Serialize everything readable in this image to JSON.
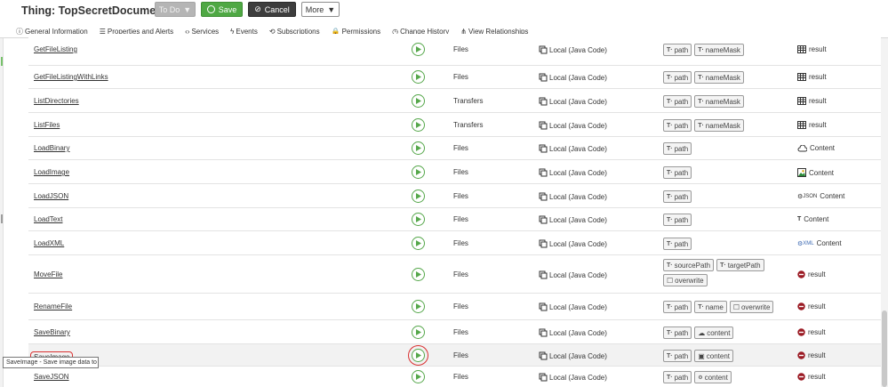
{
  "header": {
    "title_prefix": "Thing:",
    "thing_name": "TopSecretDocuments",
    "todo_label": "To Do",
    "save_label": "Save",
    "cancel_label": "Cancel",
    "more_label": "More"
  },
  "tabs": [
    {
      "label": "General Information",
      "icon": "info-icon"
    },
    {
      "label": "Properties and Alerts",
      "icon": "list-icon"
    },
    {
      "label": "Services",
      "icon": "code-icon"
    },
    {
      "label": "Events",
      "icon": "lightning-icon"
    },
    {
      "label": "Subscriptions",
      "icon": "subscription-icon"
    },
    {
      "label": "Permissions",
      "icon": "lock-icon"
    },
    {
      "label": "Change History",
      "icon": "history-icon"
    },
    {
      "label": "View Relationships",
      "icon": "relationships-icon"
    }
  ],
  "services": [
    {
      "name": "GetFileListing",
      "category": "Files",
      "source": "Local (Java Code)",
      "params": [
        {
          "type": "T",
          "name": "path"
        },
        {
          "type": "T",
          "name": "nameMask"
        }
      ],
      "result": "result",
      "result_icon": "table-icon"
    },
    {
      "name": "GetFileListingWithLinks",
      "category": "Files",
      "source": "Local (Java Code)",
      "params": [
        {
          "type": "T",
          "name": "path"
        },
        {
          "type": "T",
          "name": "nameMask"
        }
      ],
      "result": "result",
      "result_icon": "table-icon"
    },
    {
      "name": "ListDirectories",
      "category": "Transfers",
      "source": "Local (Java Code)",
      "params": [
        {
          "type": "T",
          "name": "path"
        },
        {
          "type": "T",
          "name": "nameMask"
        }
      ],
      "result": "result",
      "result_icon": "table-icon"
    },
    {
      "name": "ListFiles",
      "category": "Transfers",
      "source": "Local (Java Code)",
      "params": [
        {
          "type": "T",
          "name": "path"
        },
        {
          "type": "T",
          "name": "nameMask"
        }
      ],
      "result": "result",
      "result_icon": "table-icon"
    },
    {
      "name": "LoadBinary",
      "category": "Files",
      "source": "Local (Java Code)",
      "params": [
        {
          "type": "T",
          "name": "path"
        }
      ],
      "result": "Content",
      "result_icon": "cloud-icon"
    },
    {
      "name": "LoadImage",
      "category": "Files",
      "source": "Local (Java Code)",
      "params": [
        {
          "type": "T",
          "name": "path"
        }
      ],
      "result": "Content",
      "result_icon": "image-icon"
    },
    {
      "name": "LoadJSON",
      "category": "Files",
      "source": "Local (Java Code)",
      "params": [
        {
          "type": "T",
          "name": "path"
        }
      ],
      "result": "Content",
      "result_icon": "json-icon"
    },
    {
      "name": "LoadText",
      "category": "Files",
      "source": "Local (Java Code)",
      "params": [
        {
          "type": "T",
          "name": "path"
        }
      ],
      "result": "Content",
      "result_icon": "text-icon"
    },
    {
      "name": "LoadXML",
      "category": "Files",
      "source": "Local (Java Code)",
      "params": [
        {
          "type": "T",
          "name": "path"
        }
      ],
      "result": "Content",
      "result_icon": "xml-icon"
    },
    {
      "name": "MoveFile",
      "category": "Files",
      "source": "Local (Java Code)",
      "params": [
        {
          "type": "T",
          "name": "sourcePath"
        },
        {
          "type": "T",
          "name": "targetPath"
        },
        {
          "type": "B",
          "name": "overwrite"
        }
      ],
      "result": "result",
      "result_icon": "no-entry-icon"
    },
    {
      "name": "RenameFile",
      "category": "Files",
      "source": "Local (Java Code)",
      "params": [
        {
          "type": "T",
          "name": "path"
        },
        {
          "type": "T",
          "name": "name"
        },
        {
          "type": "B",
          "name": "overwrite"
        }
      ],
      "result": "result",
      "result_icon": "no-entry-icon"
    },
    {
      "name": "SaveBinary",
      "category": "Files",
      "source": "Local (Java Code)",
      "params": [
        {
          "type": "T",
          "name": "path"
        },
        {
          "type": "C",
          "name": "content"
        }
      ],
      "result": "result",
      "result_icon": "no-entry-icon"
    },
    {
      "name": "SaveImage",
      "category": "Files",
      "source": "Local (Java Code)",
      "params": [
        {
          "type": "T",
          "name": "path"
        },
        {
          "type": "I",
          "name": "content"
        }
      ],
      "result": "result",
      "result_icon": "no-entry-icon",
      "highlighted": true
    },
    {
      "name": "SaveJSON",
      "category": "Files",
      "source": "Local (Java Code)",
      "params": [
        {
          "type": "T",
          "name": "path"
        },
        {
          "type": "J",
          "name": "content"
        }
      ],
      "result": "result",
      "result_icon": "no-entry-icon"
    }
  ],
  "tooltip": "SaveImage - Save image data to a file"
}
